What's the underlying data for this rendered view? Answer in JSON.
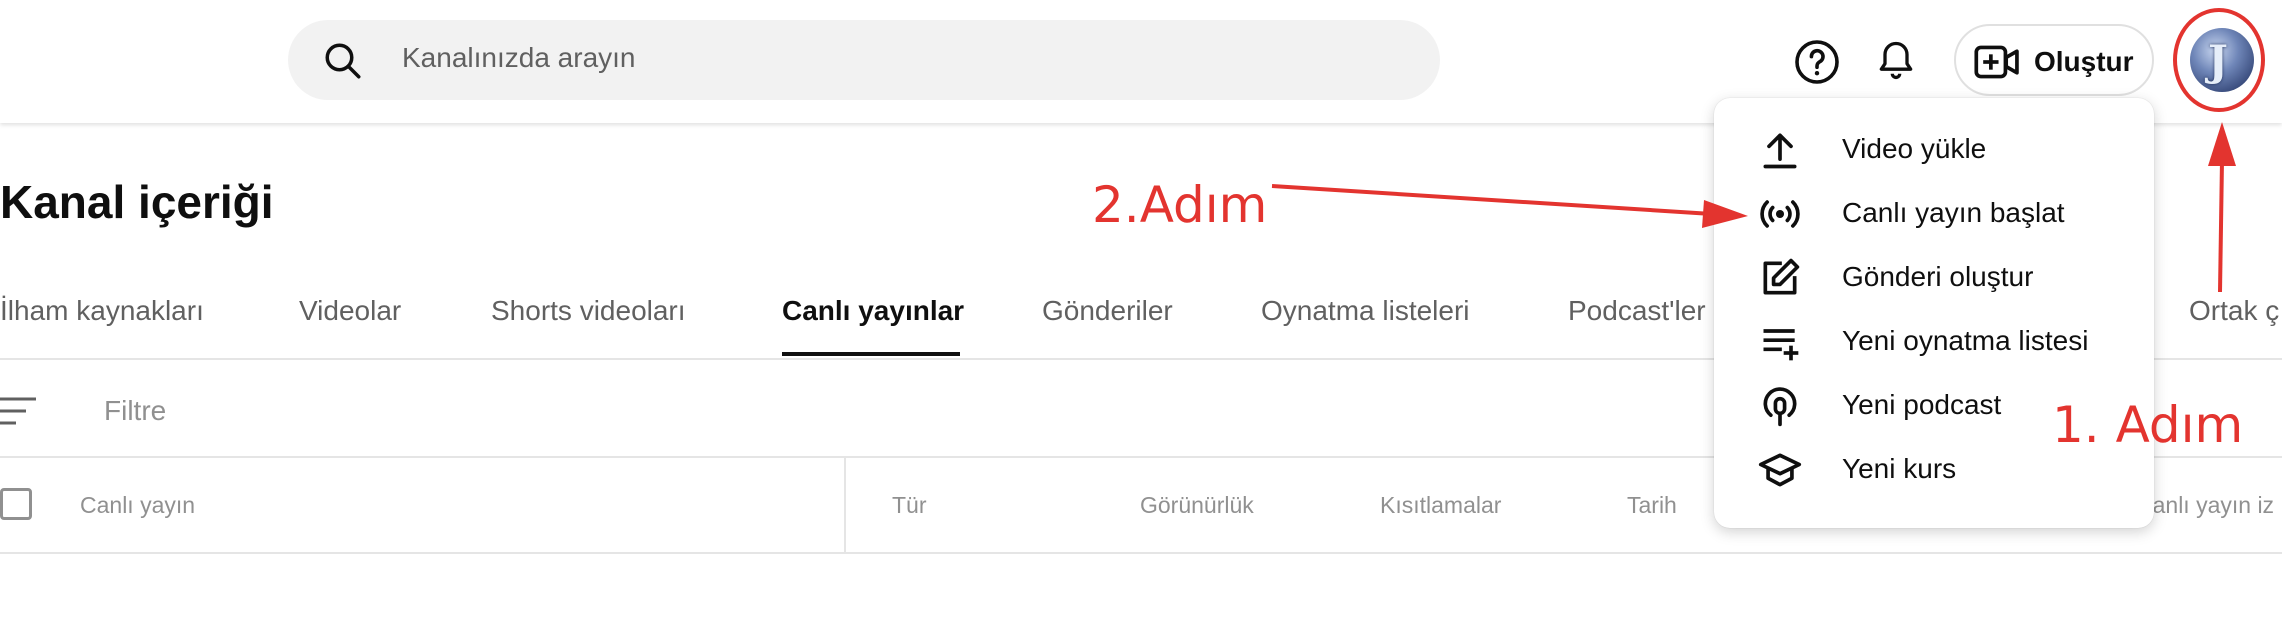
{
  "header": {
    "search_placeholder": "Kanalınızda arayın",
    "create_label": "Oluştur",
    "avatar_glyph": "J"
  },
  "page": {
    "title": "Kanal içeriği"
  },
  "tabs": [
    {
      "label": "İlham kaynakları"
    },
    {
      "label": "Videolar"
    },
    {
      "label": "Shorts videoları"
    },
    {
      "label": "Canlı yayınlar",
      "active": true
    },
    {
      "label": "Gönderiler"
    },
    {
      "label": "Oynatma listeleri"
    },
    {
      "label": "Podcast'ler"
    },
    {
      "label": "Ortak ç"
    }
  ],
  "filter": {
    "placeholder": "Filtre"
  },
  "table": {
    "columns": [
      "Canlı yayın",
      "Tür",
      "Görünürlük",
      "Kısıtlamalar",
      "Tarih",
      "Canlı yayın iz"
    ]
  },
  "menu": {
    "items": [
      {
        "label": "Video yükle",
        "icon": "upload-icon"
      },
      {
        "label": "Canlı yayın başlat",
        "icon": "live-broadcast-icon"
      },
      {
        "label": "Gönderi oluştur",
        "icon": "edit-post-icon"
      },
      {
        "label": "Yeni oynatma listesi",
        "icon": "playlist-add-icon"
      },
      {
        "label": "Yeni podcast",
        "icon": "podcast-icon"
      },
      {
        "label": "Yeni kurs",
        "icon": "course-icon"
      }
    ]
  },
  "annotations": {
    "step1": "1. Adım",
    "step2": "2.Adım",
    "color": "#e3342f"
  }
}
